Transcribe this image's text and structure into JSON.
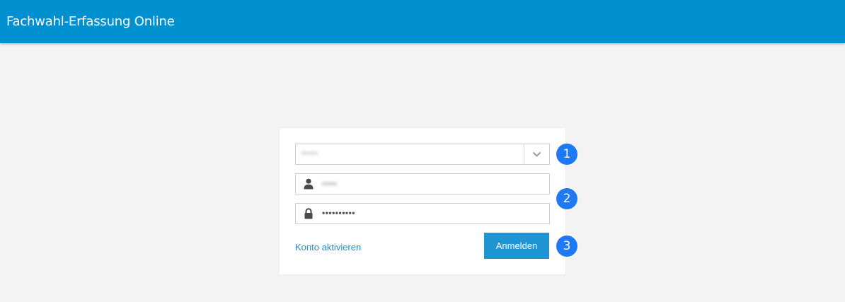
{
  "header": {
    "title": "Fachwahl-Erfassung Online",
    "background_color": "#0090d0"
  },
  "login": {
    "school_select": {
      "value": "••••••"
    },
    "username": {
      "value": "•••••",
      "icon": "user-icon"
    },
    "password": {
      "value": "••••••••••",
      "icon": "lock-icon"
    },
    "activate_link": "Konto aktivieren",
    "submit_label": "Anmelden",
    "button_color": "#1f96d3"
  },
  "annotations": {
    "badges": [
      "1",
      "2",
      "3"
    ],
    "badge_color": "#1f79f7"
  }
}
